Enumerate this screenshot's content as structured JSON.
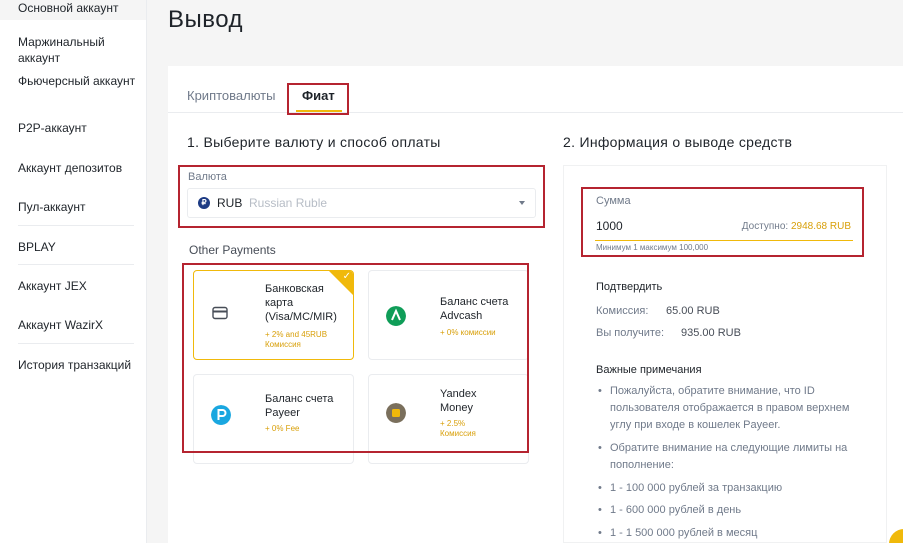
{
  "sidebar": {
    "items": [
      {
        "label": "Основной аккаунт"
      },
      {
        "label": "Маржинальный аккаунт"
      },
      {
        "label": "Фьючерсный аккаунт"
      },
      {
        "label": "P2P-аккаунт"
      },
      {
        "label": "Аккаунт депозитов"
      },
      {
        "label": "Пул-аккаунт"
      },
      {
        "label": "BPLAY"
      },
      {
        "label": "Аккаунт JEX"
      },
      {
        "label": "Аккаунт WazirX"
      },
      {
        "label": "История транзакций"
      }
    ]
  },
  "page": {
    "title": "Вывод"
  },
  "tabs": [
    {
      "label": "Криптовалюты"
    },
    {
      "label": "Фиат"
    }
  ],
  "left": {
    "title": "1. Выберите валюту и способ оплаты",
    "currency_label": "Валюта",
    "currency": {
      "icon": "ruble-coin-icon",
      "icon_glyph": "₽",
      "code": "RUB",
      "name": "Russian Ruble"
    },
    "other_title": "Other Payments",
    "payments": [
      {
        "title": "Банковская карта (Visa/MC/MIR)",
        "fee": "+ 2% and 45RUB Комиссия",
        "icon": "bank-card-icon",
        "selected": true
      },
      {
        "title": "Баланс счета Advcash",
        "fee": "+ 0% комиссии",
        "icon": "advcash-icon",
        "selected": false
      },
      {
        "title": "Баланс счета Payeer",
        "fee": "+ 0% Fee",
        "icon": "payeer-icon",
        "selected": false
      },
      {
        "title": "Yandex Money",
        "fee": "+ 2.5% Комиссия",
        "icon": "yandex-money-icon",
        "selected": false
      }
    ]
  },
  "right": {
    "title": "2. Информация о выводе средств",
    "amount_label": "Сумма",
    "amount_value": "1000",
    "available_label": "Доступно:",
    "available_value": "2948.68 RUB",
    "minmax": "Минимум 1 максимум 100,000",
    "confirm_title": "Подтвердить",
    "fee_label": "Комиссия:",
    "fee_value": "65.00 RUB",
    "receive_label": "Вы получите:",
    "receive_value": "935.00 RUB",
    "notes_title": "Важные примечания",
    "notes": [
      "Пожалуйста, обратите внимание, что ID пользователя отображается в правом верхнем углу при входе в кошелек Payeer.",
      "Обратите внимание на следующие лимиты на пополнение:",
      "1 - 100 000 рублей за транзакцию",
      "1 - 600 000 рублей в день",
      "1 - 1 500 000 рублей в месяц"
    ],
    "bullet": "•"
  },
  "colors": {
    "accent": "#f0b90b",
    "annotation": "#b52430"
  }
}
